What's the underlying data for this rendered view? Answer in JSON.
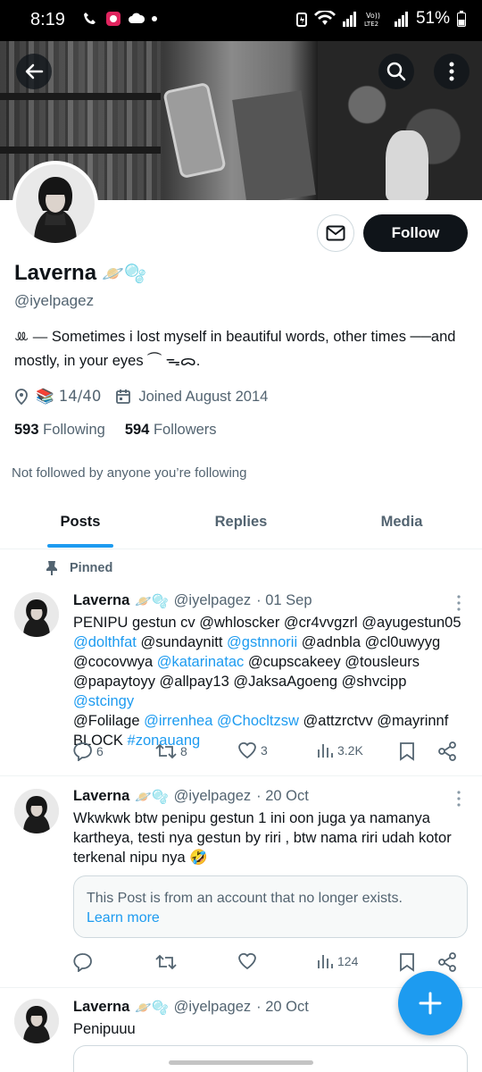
{
  "status_bar": {
    "time": "8:19",
    "battery": "51%"
  },
  "profile": {
    "display_name": "Laverna",
    "name_emoji": "🪐🫧",
    "handle": "@iyelpagez",
    "bio": "ꔛ ⎯⎯ Sometimes i lost myself in beautiful words, other times ──and mostly, in your eyes ⏜  ᯓᯅ.",
    "location": "📚 14/40",
    "joined": "Joined August 2014",
    "following_count": "593",
    "following_label": "Following",
    "followers_count": "594",
    "followers_label": "Followers",
    "not_followed": "Not followed by anyone you’re following",
    "follow_label": "Follow"
  },
  "tabs": [
    {
      "label": "Posts",
      "active": true
    },
    {
      "label": "Replies",
      "active": false
    },
    {
      "label": "Media",
      "active": false
    }
  ],
  "pinned_label": "Pinned",
  "posts": [
    {
      "name": "Laverna",
      "emoji": "🪐🫧",
      "handle": "@iyelpagez",
      "date": "· 01 Sep",
      "line1": "PENIPU gestun cv  @whloscker @cr4vvgzrl @ayugestun05",
      "line2a": "@dolthfat",
      "line2b": " @sundaynitt  ",
      "line2c": "@gstnnorii",
      "line2d": " @adnbla  @cl0uwyyg",
      "line3a": "@cocovwya ",
      "line3b": "@katarinatac",
      "line3c": " @cupscakeey @tousleurs",
      "line4a": "@papaytoyy @allpay13 @JaksaAgoeng @shvcipp ",
      "line4b": "@stcingy",
      "line5a": "@Folilage ",
      "line5b": "@irrenhea @Chocltzsw",
      "line5c": " @attzrctvv @mayrinnf",
      "line6a": "BLOCK ",
      "line6b": "#zonauang",
      "replies": "6",
      "reposts": "8",
      "likes": "3",
      "views": "3.2K"
    },
    {
      "name": "Laverna",
      "emoji": "🪐🫧",
      "handle": "@iyelpagez",
      "date": "· 20 Oct",
      "text": "Wkwkwk btw penipu gestun 1 ini oon juga ya namanya kartheya, testi nya gestun by riri , btw nama riri udah kotor terkenal nipu nya 🤣",
      "quote_text": "This Post is from an account that no longer exists.",
      "quote_link": "Learn more",
      "views": "124"
    },
    {
      "name": "Laverna",
      "emoji": "🪐🫧",
      "handle": "@iyelpagez",
      "date": "· 20 Oct",
      "text": "Penipuuu"
    }
  ],
  "colors": {
    "accent": "#1d9bf0",
    "text": "#0f1419",
    "muted": "#536471"
  }
}
